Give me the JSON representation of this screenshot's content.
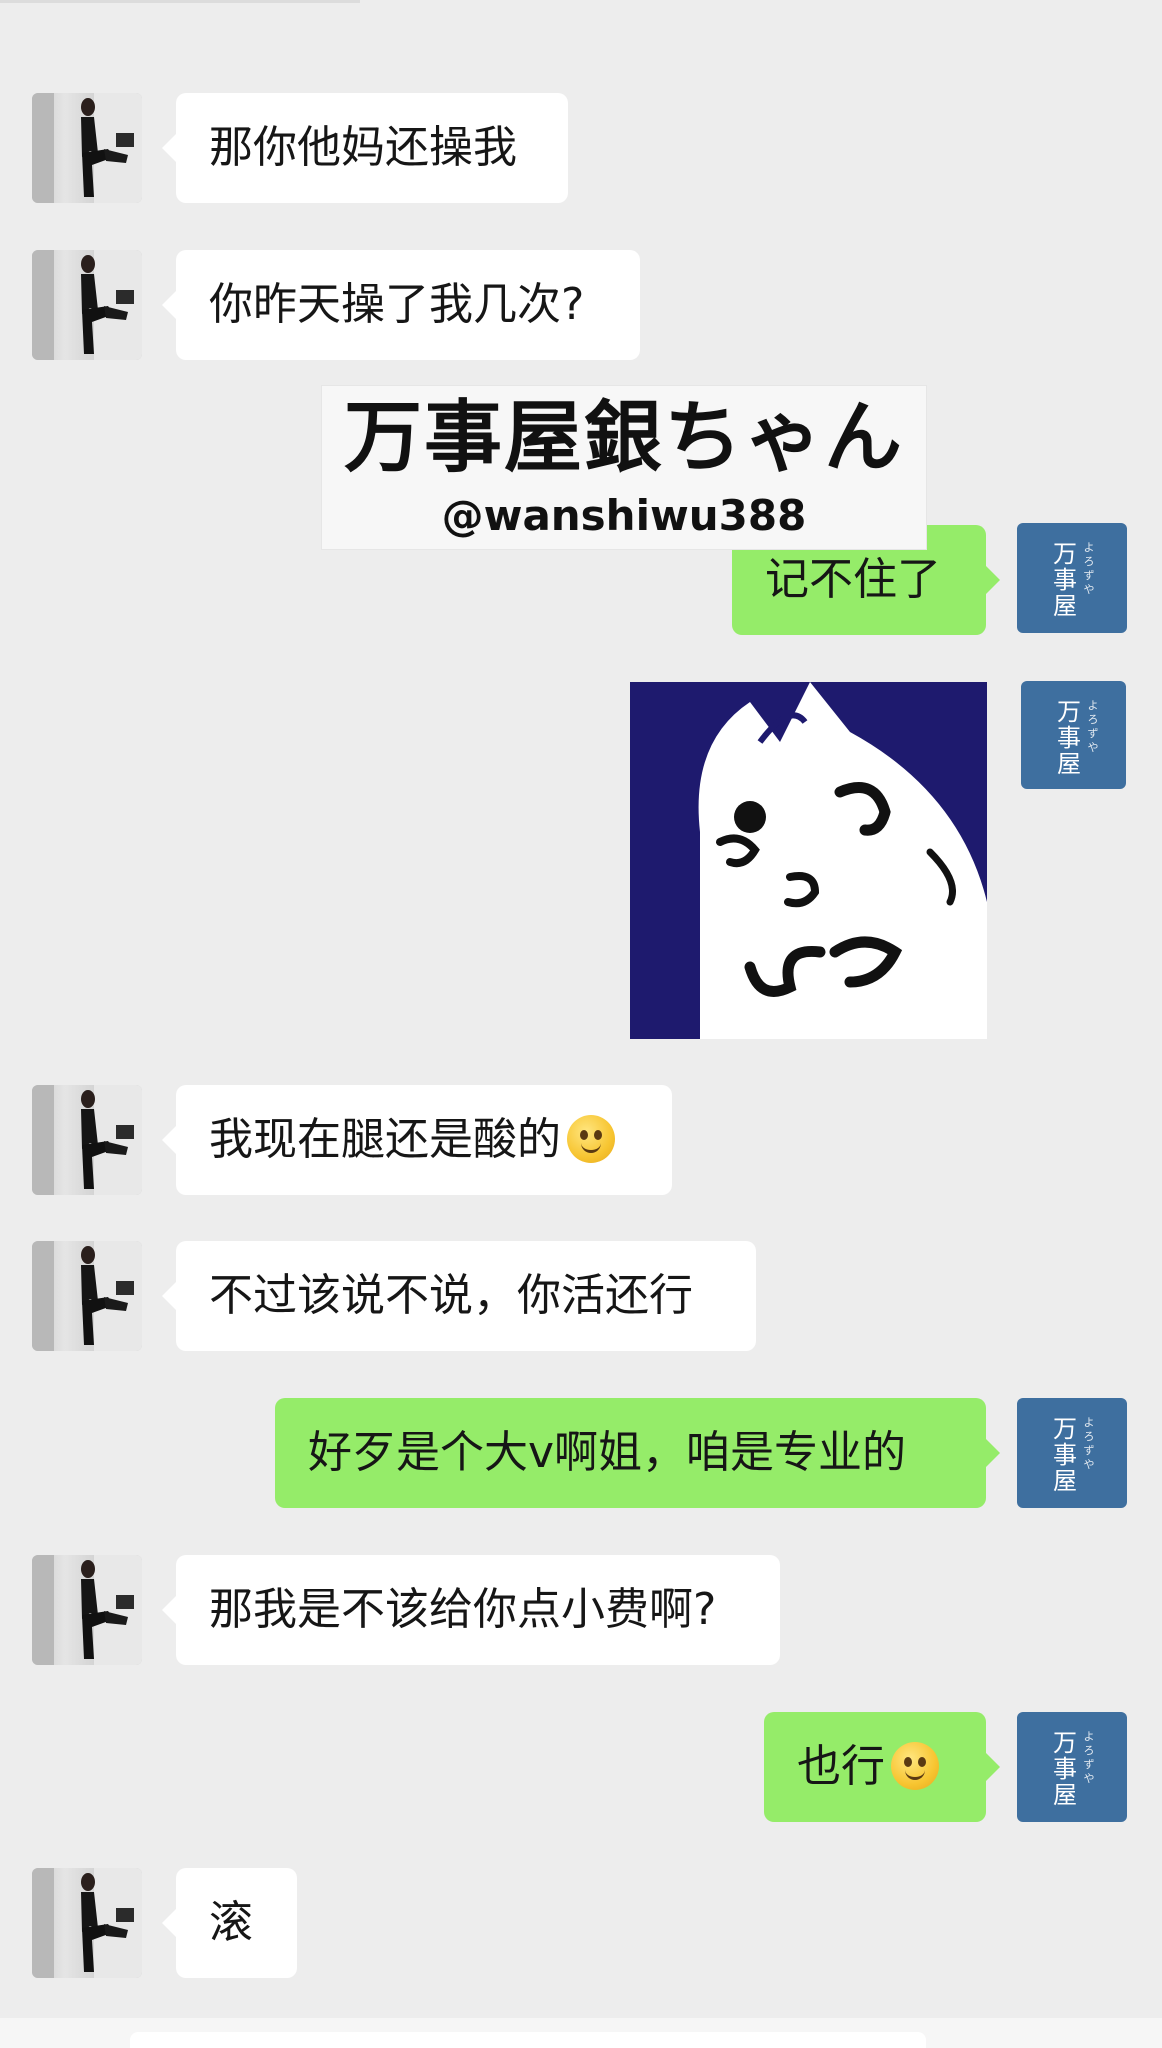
{
  "messages": [
    {
      "side": "left",
      "text": "那你他妈还操我"
    },
    {
      "side": "left",
      "text": "你昨天操了我几次?"
    },
    {
      "side": "right",
      "text": "记不住了"
    },
    {
      "side": "right",
      "type": "sticker",
      "sticker_icon": "cat-sticker-icon"
    },
    {
      "side": "left",
      "text": "我现在腿还是酸的",
      "emoji": "smile-emoji-icon"
    },
    {
      "side": "left",
      "text": "不过该说不说，你活还行"
    },
    {
      "side": "right",
      "text": "好歹是个大v啊姐，咱是专业的"
    },
    {
      "side": "left",
      "text": "那我是不该给你点小费啊?"
    },
    {
      "side": "right",
      "text": "也行",
      "emoji": "smile-emoji-icon"
    },
    {
      "side": "left",
      "text": "滚"
    }
  ],
  "self_avatar": {
    "text": "万事屋",
    "small_text": "よろずや",
    "color": "#3e6f9f"
  },
  "watermark": {
    "title": "万事屋銀ちゃん",
    "handle": "@wanshiwu388"
  },
  "colors": {
    "background": "#ededed",
    "bubble_self": "#95ec69",
    "bubble_other": "#ffffff",
    "sticker_bg": "#1e1a6e"
  }
}
